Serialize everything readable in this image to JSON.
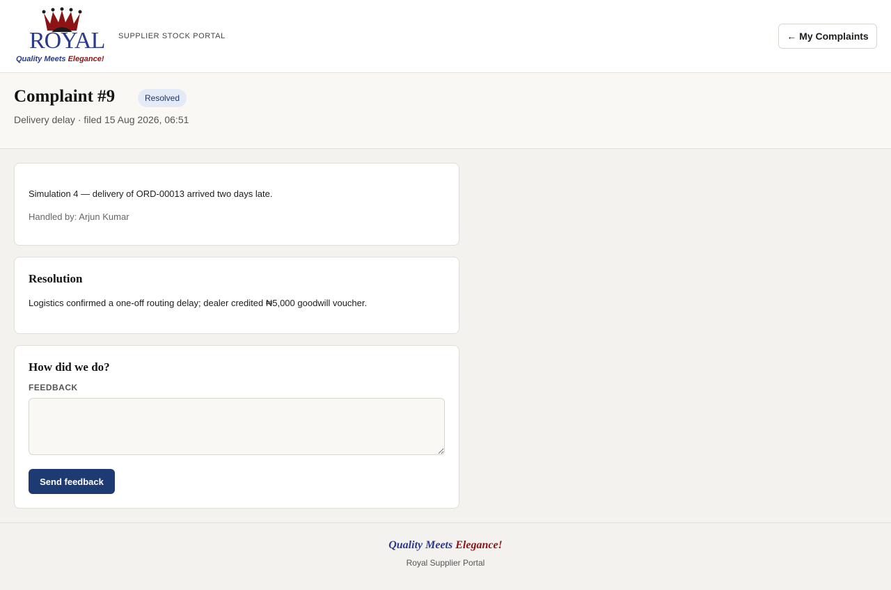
{
  "header": {
    "logo_word": "ROYAL",
    "logo_tagline_blue": "Quality Meets ",
    "logo_tagline_red": "Elegance!",
    "portal_label": "SUPPLIER STOCK PORTAL",
    "back_button": "← My Complaints"
  },
  "complaint": {
    "title": "Complaint #9",
    "status": "Resolved",
    "subtitle": "Delivery delay · filed 15 Aug 2026, 06:51",
    "description": "Simulation 4 — delivery of ORD-00013 arrived two days late.",
    "handled_by": "Handled by: Arjun Kumar"
  },
  "resolution": {
    "heading": "Resolution",
    "text": "Logistics confirmed a one-off routing delay; dealer credited ₦5,000 goodwill voucher."
  },
  "feedback": {
    "heading": "How did we do?",
    "label": "FEEDBACK",
    "value": "",
    "submit_label": "Send feedback"
  },
  "footer": {
    "tagline_blue": "Quality Meets ",
    "tagline_red": "Elegance!",
    "name": "Royal Supplier Portal"
  },
  "colors": {
    "brand_blue": "#2a3a8c",
    "brand_red": "#8c1414",
    "primary_button": "#1e3a73",
    "badge_bg": "#e4eaf6"
  },
  "icons": {
    "logo": "crown-icon"
  }
}
